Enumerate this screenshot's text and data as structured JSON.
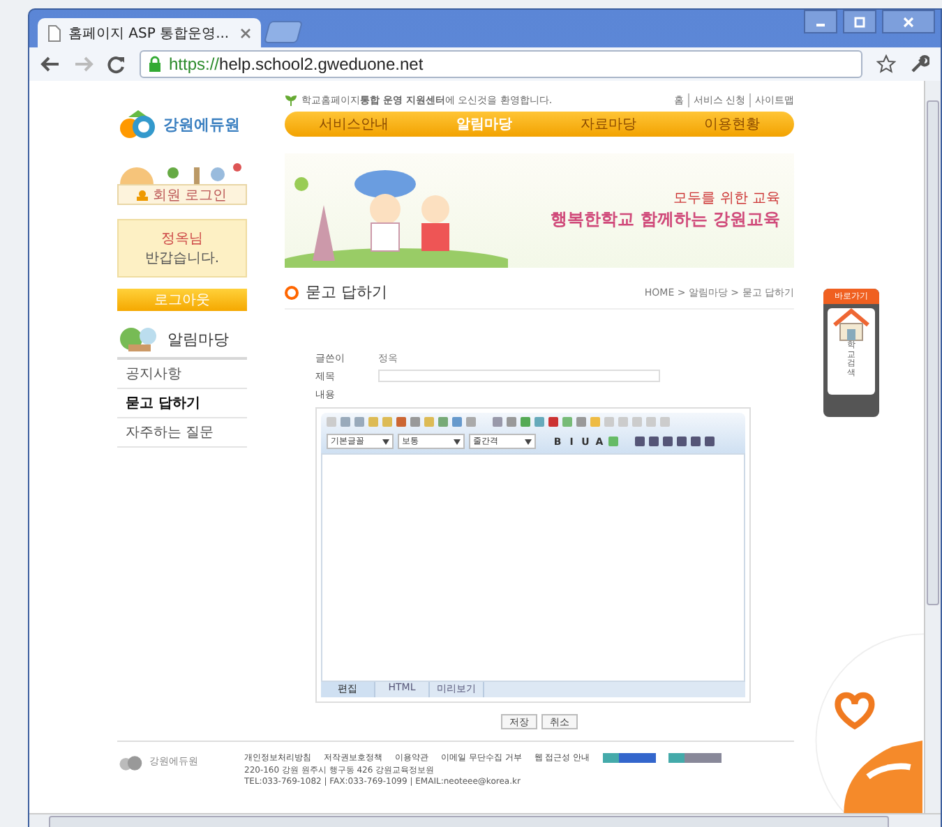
{
  "browser": {
    "tab_title": "홈페이지 ASP 통합운영...",
    "url_scheme": "https://",
    "url_host": "help.school2.gweduone.net"
  },
  "site": {
    "logo": "강원에듀원",
    "notice": "학교홈페이지**통합 운영 지원센터**에 오신것을 환영합니다.",
    "top_links": [
      "홈",
      "서비스 신청",
      "사이트맵"
    ],
    "nav": [
      {
        "label": "서비스안내",
        "selected": false
      },
      {
        "label": "알림마당",
        "selected": true
      },
      {
        "label": "자료마당",
        "selected": false
      },
      {
        "label": "이용현황",
        "selected": false
      }
    ]
  },
  "login": {
    "title": "회원 로그인",
    "user": "정옥님",
    "greeting": "반갑습니다.",
    "logout": "로그아웃"
  },
  "sidebar": {
    "title": "알림마당",
    "items": [
      {
        "label": "공지사항",
        "selected": false
      },
      {
        "label": "묻고 답하기",
        "selected": true
      },
      {
        "label": "자주하는 질문",
        "selected": false
      }
    ]
  },
  "banner": {
    "line1": "모두를 위한 교육",
    "line2": "행복한학교 함께하는 강원교육"
  },
  "page": {
    "title": "묻고 답하기",
    "breadcrumb": "HOME > 알림마당 > 묻고 답하기"
  },
  "form": {
    "author_label": "글쓴이",
    "author": "정옥",
    "subject_label": "제목",
    "content_label": "내용"
  },
  "editor": {
    "selects": [
      "기본글꼴",
      "보통",
      "줄간격"
    ],
    "format": [
      "B",
      "I",
      "U",
      "A"
    ],
    "tabs": [
      {
        "label": "편집",
        "selected": true
      },
      {
        "label": "HTML",
        "selected": false
      },
      {
        "label": "미리보기",
        "selected": false
      }
    ]
  },
  "buttons": [
    "저장",
    "취소"
  ],
  "quick_menu": {
    "title": "바로가기",
    "label": "학교검색"
  },
  "footer": {
    "logo": "강원에듀원",
    "links": [
      "개인정보처리방침",
      "저작권보호정책",
      "이용약관",
      "이메일 무단수집 거부",
      "웹 접근성 안내"
    ],
    "address": "220-160 강원 원주시 행구동 426 강원교육정보원",
    "contact": "TEL:033-769-1082 | FAX:033-769-1099 | EMAIL:neoteee@korea.kr"
  }
}
